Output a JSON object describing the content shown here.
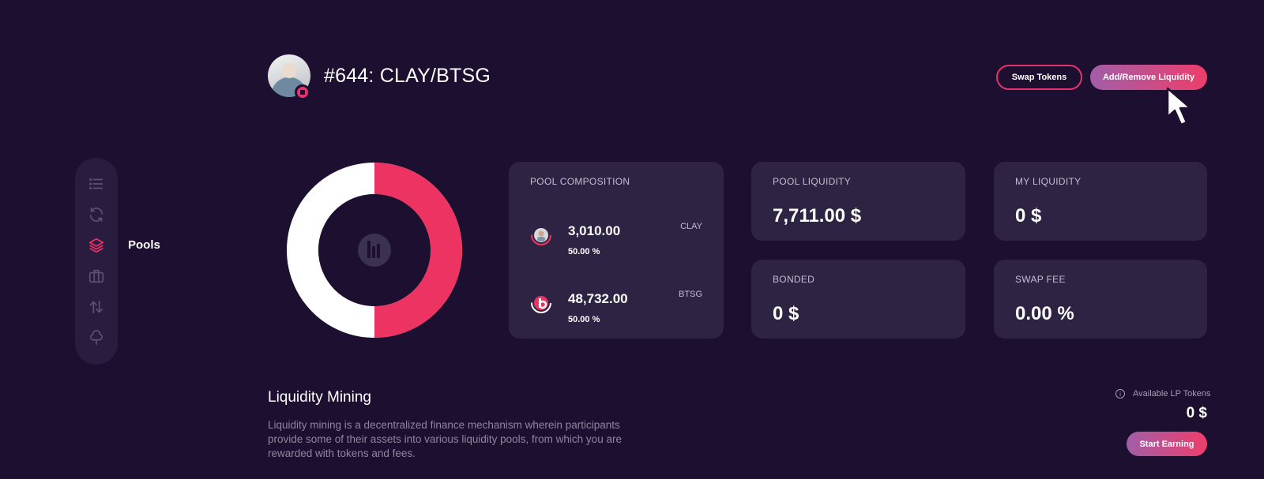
{
  "header": {
    "title": "#644: CLAY/BTSG",
    "swap_button": "Swap Tokens",
    "liquidity_button": "Add/Remove Liquidity"
  },
  "sidebar": {
    "items": [
      {
        "icon": "list-icon",
        "active": false
      },
      {
        "icon": "refresh-icon",
        "active": false
      },
      {
        "icon": "layers-icon",
        "active": true,
        "label": "Pools"
      },
      {
        "icon": "briefcase-icon",
        "active": false
      },
      {
        "icon": "transfer-icon",
        "active": false
      },
      {
        "icon": "tree-icon",
        "active": false
      }
    ],
    "active_label": "Pools"
  },
  "pool_composition": {
    "label": "POOL COMPOSITION",
    "tokens": [
      {
        "amount": "3,010.00",
        "percent": "50.00 %",
        "symbol": "CLAY"
      },
      {
        "amount": "48,732.00",
        "percent": "50.00 %",
        "symbol": "BTSG"
      }
    ]
  },
  "stats": {
    "pool_liquidity": {
      "label": "POOL LIQUIDITY",
      "value": "7,711.00 $"
    },
    "my_liquidity": {
      "label": "MY LIQUIDITY",
      "value": "0 $"
    },
    "bonded": {
      "label": "BONDED",
      "value": "0 $"
    },
    "swap_fee": {
      "label": "SWAP FEE",
      "value": "0.00 %"
    }
  },
  "donut": {
    "shares": [
      {
        "symbol": "BTSG",
        "fraction": 0.5,
        "color": "#ec3361"
      },
      {
        "symbol": "CLAY",
        "fraction": 0.5,
        "color": "#ffffff"
      }
    ]
  },
  "liquidity_mining": {
    "title": "Liquidity Mining",
    "description": "Liquidity mining is a decentralized finance mechanism wherein participants provide some of their assets into various liquidity pools, from which you are rewarded with tokens and fees.",
    "lp_label": "Available LP Tokens",
    "lp_value": "0 $",
    "start_button": "Start Earning"
  },
  "colors": {
    "background": "#1d0f30",
    "card": "#2f2344",
    "accent": "#e7336d",
    "gradient_start": "#a25ea8",
    "gradient_end": "#ee3d6b"
  }
}
